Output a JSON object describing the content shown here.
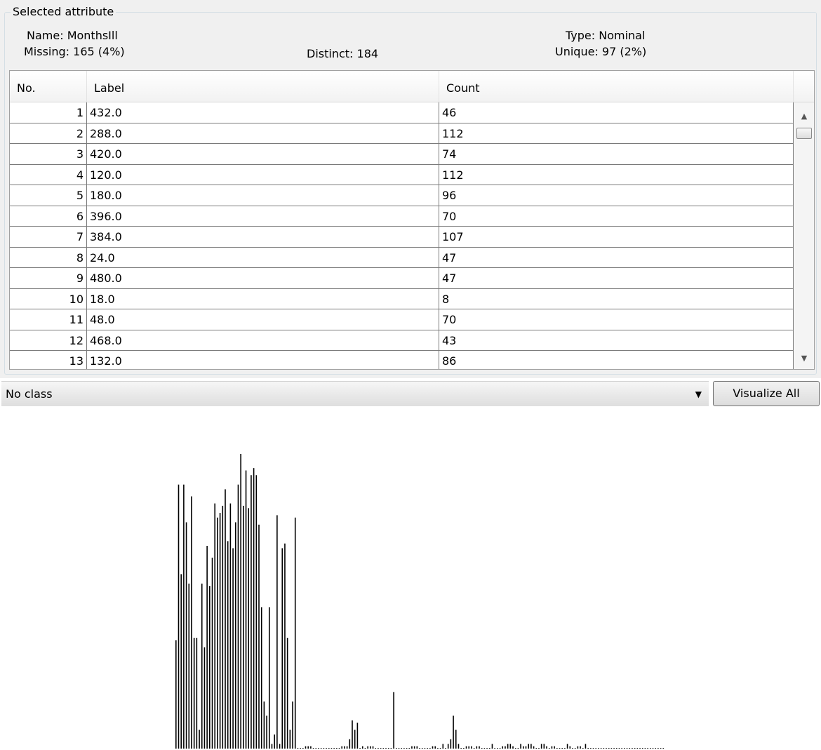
{
  "attribute": {
    "legend": "Selected attribute",
    "name_label": "Name:",
    "name_value": "MonthsIll",
    "type_label": "Type:",
    "type_value": "Nominal",
    "missing_label": "Missing:",
    "missing_value": "165 (4%)",
    "distinct_label": "Distinct:",
    "distinct_value": "184",
    "unique_label": "Unique:",
    "unique_value": "97 (2%)"
  },
  "table": {
    "headers": [
      "No.",
      "Label",
      "Count"
    ],
    "rows": [
      {
        "no": "1",
        "label": "432.0",
        "count": "46"
      },
      {
        "no": "2",
        "label": "288.0",
        "count": "112"
      },
      {
        "no": "3",
        "label": "420.0",
        "count": "74"
      },
      {
        "no": "4",
        "label": "120.0",
        "count": "112"
      },
      {
        "no": "5",
        "label": "180.0",
        "count": "96"
      },
      {
        "no": "6",
        "label": "396.0",
        "count": "70"
      },
      {
        "no": "7",
        "label": "384.0",
        "count": "107"
      },
      {
        "no": "8",
        "label": "24.0",
        "count": "47"
      },
      {
        "no": "9",
        "label": "480.0",
        "count": "47"
      },
      {
        "no": "10",
        "label": "18.0",
        "count": "8"
      },
      {
        "no": "11",
        "label": "48.0",
        "count": "70"
      },
      {
        "no": "12",
        "label": "468.0",
        "count": "43"
      },
      {
        "no": "13",
        "label": "132.0",
        "count": "86"
      }
    ]
  },
  "class_selector": {
    "value": "No class"
  },
  "visualize_button": {
    "label": "Visualize All"
  },
  "icons": {
    "dropdown": "chevron-down-icon",
    "scroll_up": "scroll-up-icon",
    "scroll_down": "scroll-down-icon"
  },
  "colors": {
    "bar": "#000000",
    "panel": "#f0f0f0"
  },
  "chart_data": {
    "type": "bar",
    "ylim": [
      0,
      125
    ],
    "grid": false,
    "values": [
      46,
      112,
      74,
      112,
      96,
      70,
      107,
      47,
      47,
      8,
      70,
      43,
      86,
      69,
      81,
      104,
      98,
      100,
      103,
      110,
      88,
      104,
      85,
      96,
      112,
      125,
      103,
      118,
      102,
      116,
      119,
      116,
      95,
      60,
      20,
      14,
      60,
      2,
      6,
      99,
      2,
      85,
      87,
      47,
      8,
      20,
      98,
      0,
      0,
      0,
      1,
      1,
      1,
      0,
      0,
      0,
      0,
      0,
      0,
      0,
      0,
      0,
      0,
      0,
      1,
      1,
      1,
      4,
      12,
      8,
      11,
      0,
      1,
      0,
      1,
      1,
      1,
      0,
      0,
      0,
      0,
      0,
      0,
      0,
      24,
      0,
      0,
      0,
      0,
      0,
      0,
      1,
      1,
      1,
      0,
      0,
      0,
      0,
      0,
      1,
      1,
      0,
      0,
      2,
      0,
      2,
      4,
      14,
      8,
      2,
      0,
      0,
      1,
      1,
      1,
      0,
      1,
      1,
      0,
      0,
      0,
      0,
      2,
      0,
      0,
      0,
      1,
      1,
      2,
      2,
      1,
      0,
      0,
      2,
      1,
      1,
      2,
      2,
      1,
      0,
      0,
      2,
      2,
      1,
      0,
      1,
      1,
      0,
      0,
      0,
      0,
      2,
      1,
      0,
      0,
      1,
      1,
      0,
      2,
      0,
      0,
      0,
      0,
      0,
      0,
      0,
      0,
      0,
      0,
      0,
      0,
      0,
      0,
      0,
      0,
      0,
      0,
      0,
      0,
      0,
      0,
      0,
      0,
      0,
      0,
      0,
      0,
      0,
      0
    ]
  }
}
